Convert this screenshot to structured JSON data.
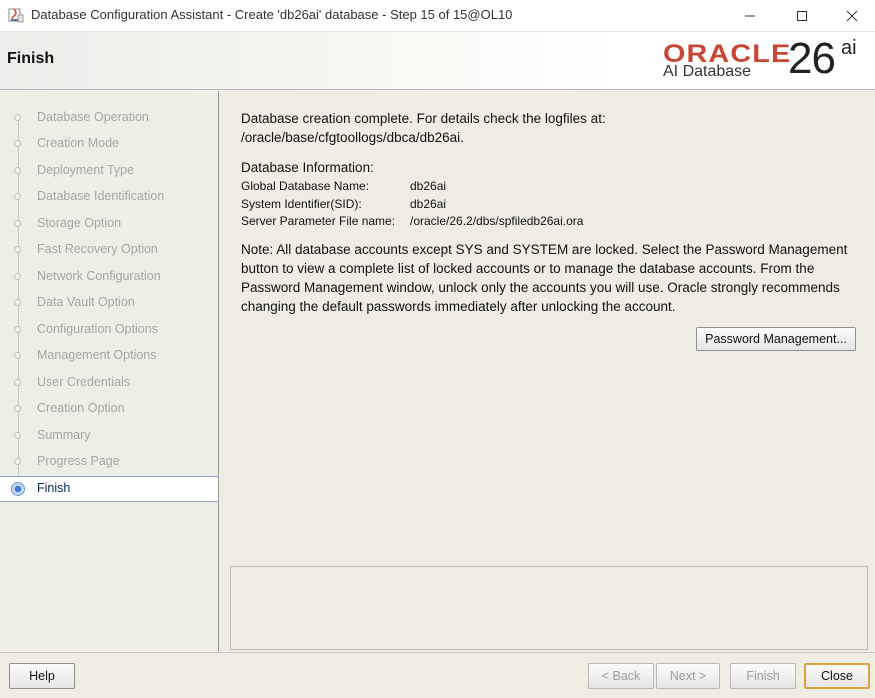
{
  "window": {
    "title": "Database Configuration Assistant - Create 'db26ai' database - Step 15 of 15@OL10",
    "icon": "java-app-icon"
  },
  "header": {
    "title": "Finish",
    "logo_word": "ORACLE",
    "logo_sub": "AI Database",
    "logo_version": "26",
    "logo_version_suffix": "ai",
    "brand_color": "#c74634"
  },
  "nav": {
    "items": [
      {
        "label": "Database Operation"
      },
      {
        "label": "Creation Mode"
      },
      {
        "label": "Deployment Type"
      },
      {
        "label": "Database Identification"
      },
      {
        "label": "Storage Option"
      },
      {
        "label": "Fast Recovery Option"
      },
      {
        "label": "Network Configuration"
      },
      {
        "label": "Data Vault Option"
      },
      {
        "label": "Configuration Options"
      },
      {
        "label": "Management Options"
      },
      {
        "label": "User Credentials"
      },
      {
        "label": "Creation Option"
      },
      {
        "label": "Summary"
      },
      {
        "label": "Progress Page"
      },
      {
        "label": "Finish",
        "active": true
      }
    ]
  },
  "main": {
    "complete_line1": "Database creation complete. For details check the logfiles at:",
    "complete_line2": " /oracle/base/cfgtoollogs/dbca/db26ai.",
    "info_heading": "Database Information:",
    "info": [
      {
        "label": "Global Database Name:",
        "value": "db26ai"
      },
      {
        "label": "System Identifier(SID):",
        "value": "db26ai"
      },
      {
        "label": "Server Parameter File name:",
        "value": "/oracle/26.2/dbs/spfiledb26ai.ora"
      }
    ],
    "note_lines": [
      "Note: All database accounts except SYS and SYSTEM are locked. Select the Password Management",
      "button to view a complete list of locked accounts or to manage the database accounts. From the",
      "Password Management window, unlock only the accounts you will use. Oracle strongly recommends",
      "changing the default passwords immediately after unlocking the account."
    ],
    "password_button": "Password Management...",
    "message_box": ""
  },
  "footer": {
    "help": "Help",
    "back": "< Back",
    "next": "Next >",
    "finish": "Finish",
    "close": "Close"
  }
}
